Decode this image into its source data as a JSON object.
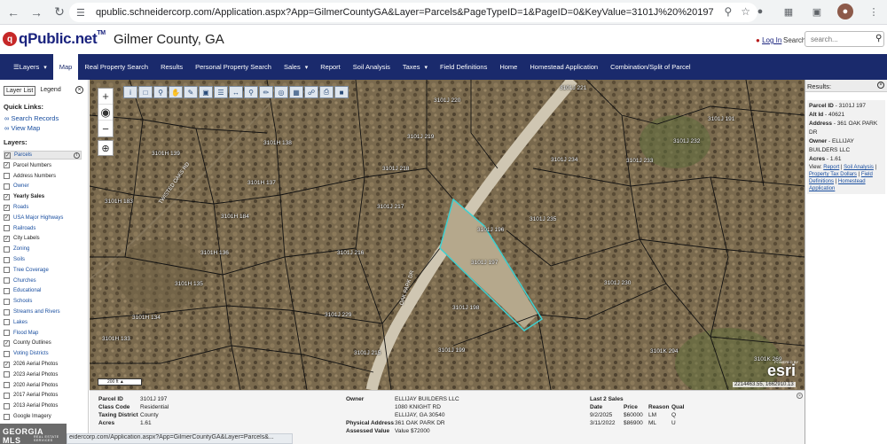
{
  "browser": {
    "url": "qpublic.schneidercorp.com/Application.aspx?App=GilmerCountyGA&Layer=Parcels&PageTypeID=1&PageID=0&KeyValue=3101J%20%20197"
  },
  "header": {
    "logo_text": "qPublic.net",
    "logo_tm": "TM",
    "county": "Gilmer County, GA",
    "login": "Log In",
    "search_label": "Search",
    "search_placeholder": "search..."
  },
  "nav": {
    "items": [
      {
        "label": "Layers",
        "caret": true
      },
      {
        "label": "Map",
        "active": true
      },
      {
        "label": "Real Property Search"
      },
      {
        "label": "Results"
      },
      {
        "label": "Personal Property Search"
      },
      {
        "label": "Sales",
        "caret": true
      },
      {
        "label": "Report"
      },
      {
        "label": "Soil Analysis"
      },
      {
        "label": "Taxes",
        "caret": true
      },
      {
        "label": "Field Definitions"
      },
      {
        "label": "Home"
      },
      {
        "label": "Homestead Application"
      },
      {
        "label": "Combination/Split of Parcel"
      }
    ]
  },
  "sidebar": {
    "tab_layer_list": "Layer List",
    "tab_legend": "Legend",
    "quick_links_title": "Quick Links:",
    "quick_links": [
      "Search Records",
      "View Map"
    ],
    "layers_title": "Layers:",
    "layers": [
      {
        "label": "Parcels",
        "checked": true,
        "link": true,
        "highlight": true
      },
      {
        "label": "Parcel Numbers",
        "checked": true
      },
      {
        "label": "Address Numbers",
        "checked": false
      },
      {
        "label": "Owner",
        "checked": false,
        "link": true
      },
      {
        "label": "Yearly Sales",
        "checked": true,
        "bold": true
      },
      {
        "label": "Roads",
        "checked": true,
        "link": true
      },
      {
        "label": "USA Major Highways",
        "checked": true,
        "link": true
      },
      {
        "label": "Railroads",
        "checked": false,
        "link": true
      },
      {
        "label": "City Labels",
        "checked": true
      },
      {
        "label": "Zoning",
        "checked": false,
        "link": true
      },
      {
        "label": "Soils",
        "checked": false,
        "link": true
      },
      {
        "label": "Tree Coverage",
        "checked": false,
        "link": true
      },
      {
        "label": "Churches",
        "checked": false,
        "link": true
      },
      {
        "label": "Educational",
        "checked": false,
        "link": true
      },
      {
        "label": "Schools",
        "checked": false,
        "link": true
      },
      {
        "label": "Streams and Rivers",
        "checked": false,
        "link": true
      },
      {
        "label": "Lakes",
        "checked": false,
        "link": true
      },
      {
        "label": "Flood Map",
        "checked": false,
        "link": true
      },
      {
        "label": "County Outlines",
        "checked": true
      },
      {
        "label": "Voting Districts",
        "checked": false,
        "link": true
      },
      {
        "label": "2026 Aerial Photos",
        "checked": true
      },
      {
        "label": "2023 Aerial Photos",
        "checked": false
      },
      {
        "label": "2020 Aerial Photos",
        "checked": false
      },
      {
        "label": "2017 Aerial Photos",
        "checked": false
      },
      {
        "label": "2013 Aerial Photos",
        "checked": false
      },
      {
        "label": "Google Imagery",
        "checked": false
      }
    ],
    "georgia_logo": "GEORGIA MLS",
    "georgia_logo_sub": "REAL ESTATE SERVICES"
  },
  "map": {
    "parcel_labels": [
      {
        "text": "3101J 221"
      },
      {
        "text": "3101J 220"
      },
      {
        "text": "3101J 219"
      },
      {
        "text": "3101J 218"
      },
      {
        "text": "3101J 217"
      },
      {
        "text": "3101J 216"
      },
      {
        "text": "3101J 229"
      },
      {
        "text": "3101J 215"
      },
      {
        "text": "3101J 199"
      },
      {
        "text": "3101J 198"
      },
      {
        "text": "3101J 197"
      },
      {
        "text": "3101J 196"
      },
      {
        "text": "3101J 235"
      },
      {
        "text": "3101J 234"
      },
      {
        "text": "3101J 230"
      },
      {
        "text": "3101J 233"
      },
      {
        "text": "3101J 232"
      },
      {
        "text": "3101J 191"
      },
      {
        "text": "3101K 294"
      },
      {
        "text": "3101K 269"
      },
      {
        "text": "3101H 139"
      },
      {
        "text": "3101H 138"
      },
      {
        "text": "3101H 137"
      },
      {
        "text": "3101H 183"
      },
      {
        "text": "3101H 184"
      },
      {
        "text": "3101H 136"
      },
      {
        "text": "3101H 135"
      },
      {
        "text": "3101H 134"
      },
      {
        "text": "3101H 133"
      }
    ],
    "road_labels": [
      "TWISTED OAKS RD",
      "OAK PARK DR"
    ],
    "scale": "200 ft",
    "coords": "2214463.55, 1662910.13",
    "esri": "esri",
    "esri_powered": "POWERED BY"
  },
  "results": {
    "title": "Results:",
    "parcel_id_label": "Parcel ID",
    "parcel_id": "3101J 197",
    "alt_id_label": "Alt Id",
    "alt_id": "40621",
    "address_label": "Address",
    "address": "361 OAK PARK DR",
    "owner_label": "Owner",
    "owner": "ELLIJAY BUILDERS LLC",
    "acres_label": "Acres",
    "acres": "1.61",
    "view_label": "View:",
    "view_links": [
      "Report",
      "Soil Analysis",
      "Property Tax Dollars",
      "Field Definitions",
      "Homestead Application"
    ]
  },
  "info": {
    "parcel_id_label": "Parcel ID",
    "parcel_id": "3101J 197",
    "class_code_label": "Class Code",
    "class_code": "Residential",
    "taxing_district_label": "Taxing District",
    "taxing_district": "County",
    "acres_label": "Acres",
    "acres": "1.61",
    "owner_label": "Owner",
    "owner_lines": [
      "ELLIJAY BUILDERS LLC",
      "1080 KNIGHT RD",
      "ELLIJAY, GA 30540"
    ],
    "physical_address_label": "Physical Address",
    "physical_address": "361 OAK PARK DR",
    "assessed_value_label": "Assessed Value",
    "assessed_value": "Value $72000",
    "sales_title": "Last 2 Sales",
    "sales_headers": [
      "Date",
      "Price",
      "Reason",
      "Qual"
    ],
    "sales": [
      [
        "9/2/2025",
        "$60000",
        "LM",
        "Q"
      ],
      [
        "3/11/2022",
        "$86900",
        "ML",
        "U"
      ]
    ]
  },
  "status_link": "eidercorp.com/Application.aspx?App=GilmerCountyGA&Layer=Parcels&...",
  "colors": {
    "nav_bg": "#1a2a6c",
    "logo_red": "#c62828",
    "selected_parcel": "#3fd0d0",
    "link": "#1a4fa0"
  }
}
